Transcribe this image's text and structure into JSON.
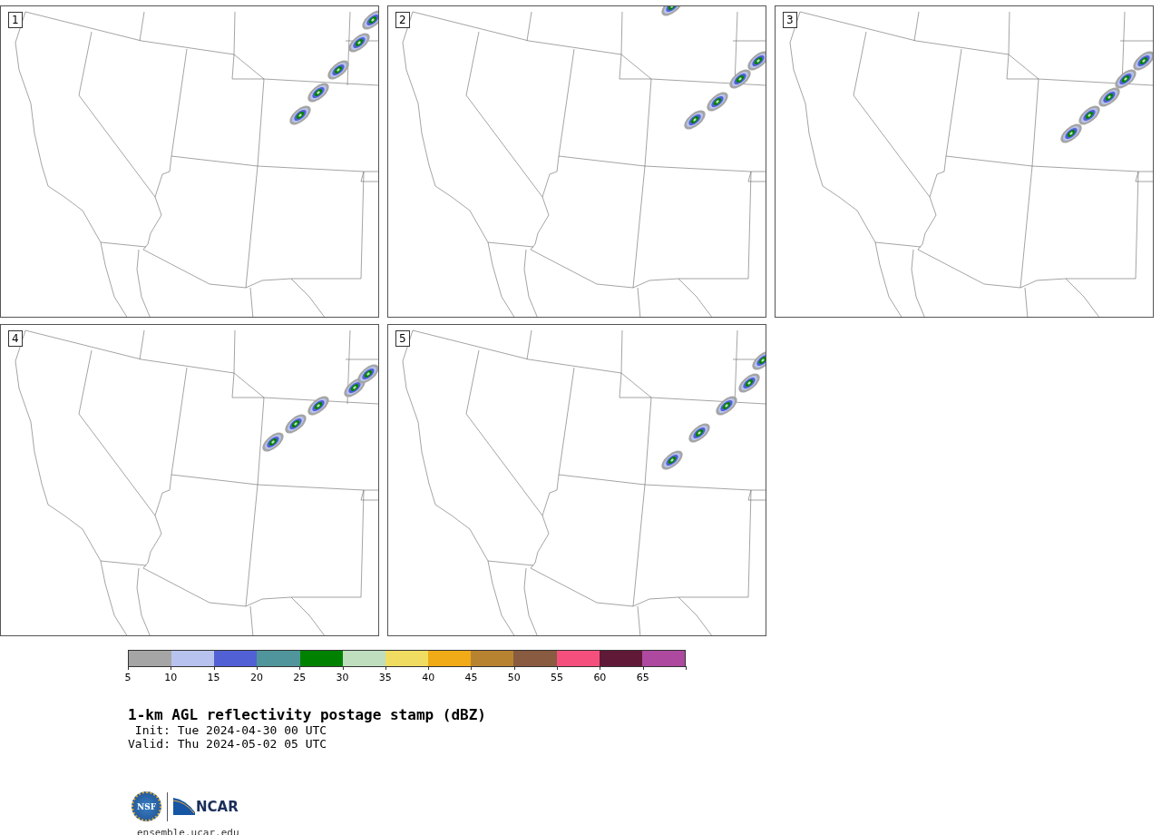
{
  "panels": [
    {
      "label": "1"
    },
    {
      "label": "2"
    },
    {
      "label": "3"
    },
    {
      "label": "4"
    },
    {
      "label": "5"
    }
  ],
  "colorbar": {
    "segments": [
      {
        "color": "#a5a5a5"
      },
      {
        "color": "#b7c3ee"
      },
      {
        "color": "#5260d6"
      },
      {
        "color": "#50959b"
      },
      {
        "color": "#008200"
      },
      {
        "color": "#bfdebe"
      },
      {
        "color": "#efdc60"
      },
      {
        "color": "#f0ab16"
      },
      {
        "color": "#b88331"
      },
      {
        "color": "#895b40"
      },
      {
        "color": "#f5507d"
      },
      {
        "color": "#601936"
      },
      {
        "color": "#ad4aa0"
      }
    ],
    "ticks": [
      "5",
      "10",
      "15",
      "20",
      "25",
      "30",
      "35",
      "40",
      "45",
      "50",
      "55",
      "60",
      "65"
    ]
  },
  "title": "1-km AGL reflectivity postage stamp (dBZ)",
  "init": "Init: Tue 2024-04-30 00 UTC",
  "valid": "Valid: Thu 2024-05-02 05 UTC",
  "logo": {
    "left": "NSF",
    "right": "NCAR"
  },
  "url": "ensemble.ucar.edu"
}
